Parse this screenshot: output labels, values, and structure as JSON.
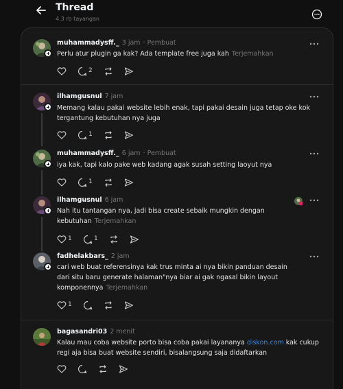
{
  "header": {
    "title": "Thread",
    "views": "4,3 rb tayangan"
  },
  "posts": [
    {
      "username": "muhammadysff._",
      "time": "3 jam",
      "author_tag": "· Pembuat",
      "text": "Perlu atur plugin ga kak? Ada template free juga kah",
      "translate": "Terjemahkan",
      "reply_count": "2"
    },
    {
      "username": "ilhamgusnul",
      "time": "7 jam",
      "text": "Memang kalau pakai website lebih enak, tapi pakai desain juga tetap oke kok tergantung kebutuhan nya juga",
      "reply_count": "1"
    },
    {
      "username": "muhammadysff._",
      "time": "6 jam",
      "author_tag": "· Pembuat",
      "text": "iya kak, tapi kalo pake web kadang agak susah setting laoyut nya",
      "reply_count": "1"
    },
    {
      "username": "ilhamgusnul",
      "time": "6 jam",
      "text": "Nah itu tantangan nya, jadi bisa create sebaik mungkin dengan kebutuhan",
      "translate": "Terjemahkan",
      "like_count": "1",
      "reply_count": "1"
    },
    {
      "username": "fadhelakbars_",
      "time": "2 jam",
      "text": "cari web buat referensinya kak trus minta ai nya bikin panduan desain dari situ baru generate halaman\"nya biar ai gak ngasal bikin layout komponennya",
      "translate": "Terjemahkan",
      "like_count": "1"
    },
    {
      "username": "bagasandri03",
      "time": "2 menit",
      "text_before": "Kalau mau coba website porto bisa coba pakai layananya ",
      "link": "diskon.com",
      "text_after": " kak cukup regi aja bisa buat website sendiri, bisalangsung saja didaftarkan"
    }
  ],
  "colors": {
    "background": "#101010",
    "card": "#181818",
    "link": "#3f87d9",
    "muted": "#777777"
  }
}
